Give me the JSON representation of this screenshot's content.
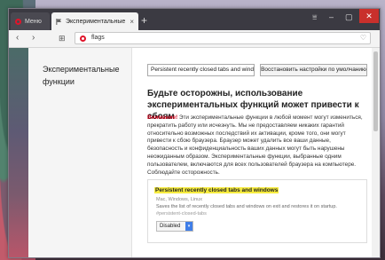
{
  "tabs": {
    "menu_label": "Меню",
    "active_label": "Экспериментальные ф",
    "close_symbol": "×",
    "new_tab_symbol": "+"
  },
  "window_controls": {
    "filter": "⩸",
    "minimize": "–",
    "maximize": "▢",
    "close": "✕"
  },
  "toolbar": {
    "back": "‹",
    "forward": "›",
    "grid": "⊞",
    "url": "flags",
    "bookmark": "♡"
  },
  "sidebar": {
    "title": "Экспериментальные функции"
  },
  "main": {
    "search_value": "Persistent recently closed tabs and wind",
    "reset_label": "Восстановить настройки по умолчанию",
    "heading": "Будьте осторожны, использование экспериментальных функций может привести к сбоям",
    "warning_alert": "Внимание!",
    "warning_text": " Эти экспериментальные функции в любой момент могут измениться, прекратить работу или исчезнуть. Мы не предоставляем никаких гарантий относительно возможных последствий их активации, кроме того, они могут привести к сбою браузера. Браузер может удалить все ваши данные, безопасность и конфиденциальность ваших данных могут быть нарушены неожиданным образом. Экспериментальные функции, выбранные одним пользователем, включаются для всех пользователей браузера на компьютере. Соблюдайте осторожность."
  },
  "flag": {
    "title": "Persistent recently closed tabs and windows",
    "platforms": "Mac, Windows, Linux",
    "description": "Saves the list of recently closed tabs and windows on exit and restores it on startup.",
    "hash": "#persistent-closed-tabs",
    "selected": "Disabled",
    "arrow": "▾"
  },
  "colors": {
    "opera_red": "#e0152b",
    "highlight": "#f7ec3f",
    "alert": "#d0021b",
    "select_accent": "#3f7ee8"
  }
}
